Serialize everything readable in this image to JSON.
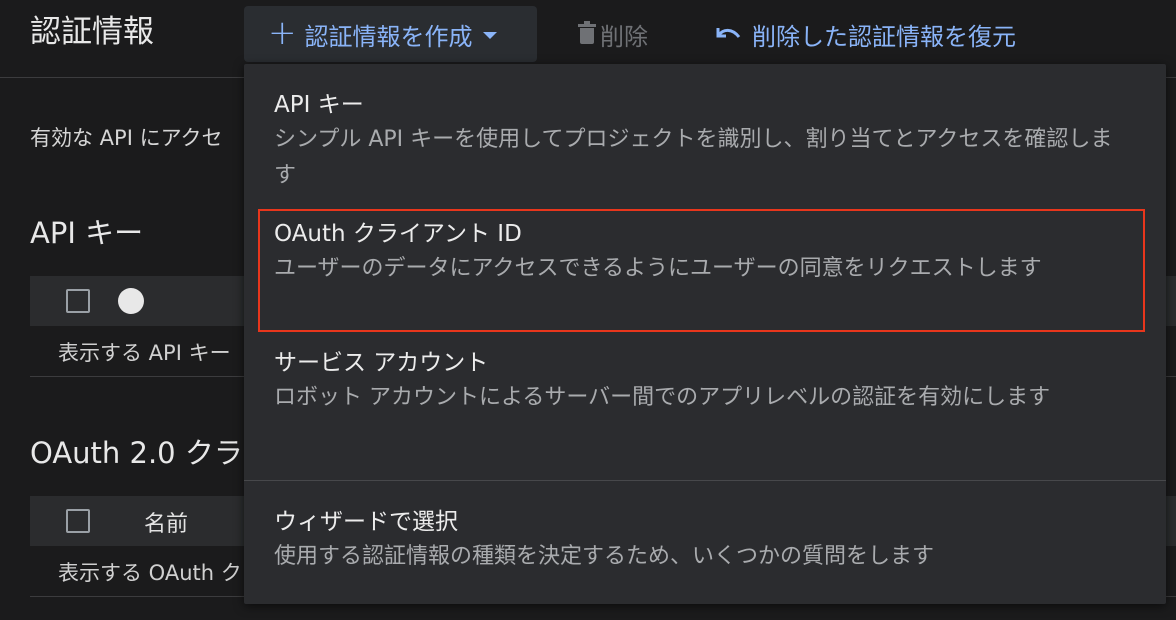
{
  "header": {
    "title": "認証情報",
    "create_label": "認証情報を作成",
    "delete_label": "削除",
    "restore_label": "削除した認証情報を復元"
  },
  "main": {
    "description": "有効な API にアクセ",
    "api_keys": {
      "title": "API キー",
      "empty_text": "表示する API キー"
    },
    "oauth": {
      "title": "OAuth 2.0 クラ",
      "column_name": "名前",
      "empty_text": "表示する OAuth ク"
    }
  },
  "menu": {
    "items": [
      {
        "title": "API キー",
        "description": "シンプル API キーを使用してプロジェクトを識別し、割り当てとアクセスを確認します"
      },
      {
        "title": "OAuth クライアント ID",
        "description": "ユーザーのデータにアクセスできるようにユーザーの同意をリクエストします"
      },
      {
        "title": "サービス アカウント",
        "description": "ロボット アカウントによるサーバー間でのアプリレベルの認証を有効にします"
      },
      {
        "title": "ウィザードで選択",
        "description": "使用する認証情報の種類を決定するため、いくつかの質問をします"
      }
    ]
  },
  "colors": {
    "accent": "#8ab4f8",
    "highlight": "#e8361c",
    "background": "#1b1b1c",
    "menu_background": "#2b2c2f"
  },
  "icons": {
    "create": "plus-icon",
    "dropdown": "caret-down-icon",
    "delete": "trash-icon",
    "restore": "undo-icon"
  }
}
